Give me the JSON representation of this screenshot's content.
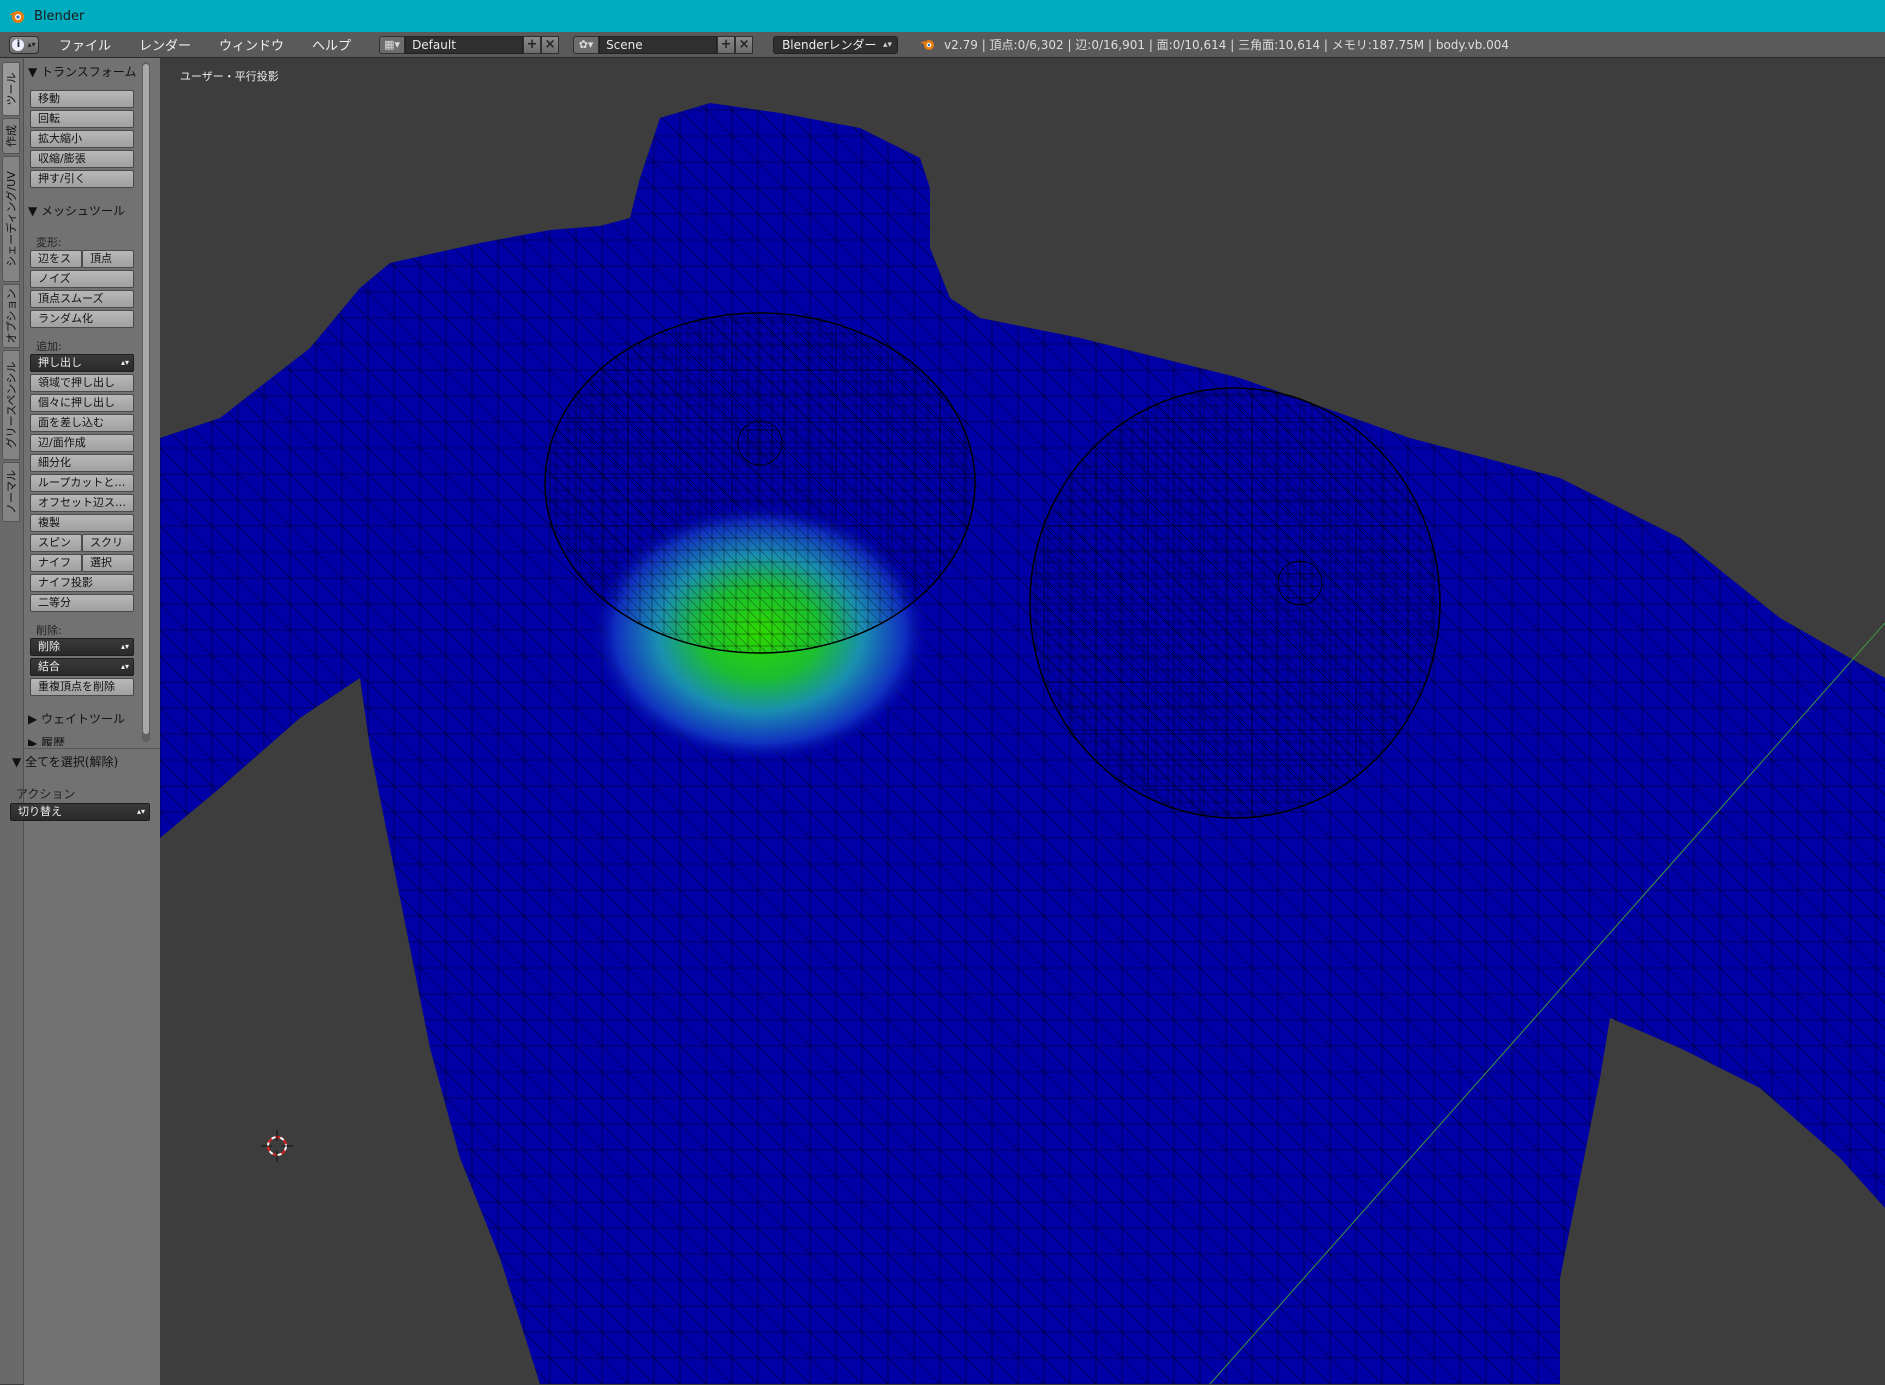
{
  "window": {
    "title": "Blender"
  },
  "menu": {
    "file": "ファイル",
    "render": "レンダー",
    "window": "ウィンドウ",
    "help": "ヘルプ"
  },
  "layout": {
    "screen": "Default",
    "scene": "Scene",
    "engine": "Blenderレンダー"
  },
  "stats": {
    "text": "v2.79 | 頂点:0/6,302 | 辺:0/16,901 | 面:0/10,614 | 三角面:10,614 | メモリ:187.75M | body.vb.004"
  },
  "vtabs": [
    "ツール",
    "作成",
    "シェーディング/UV",
    "オプション",
    "グリースペンシル",
    "ノーマル"
  ],
  "toolpanel": {
    "transform": {
      "header": "▼ トランスフォーム",
      "move": "移動",
      "rotate": "回転",
      "scale": "拡大縮小",
      "shrink": "収縮/膨張",
      "push": "押す/引く"
    },
    "mesh": {
      "header": "▼ メッシュツール",
      "deform_label": "変形:",
      "edge_slide": "辺をス",
      "vertex": "頂点",
      "noise": "ノイズ",
      "smooth": "頂点スムーズ",
      "randomize": "ランダム化",
      "add_label": "追加:",
      "extrude": "押し出し",
      "extrude_region": "領域で押し出し",
      "extrude_individual": "個々に押し出し",
      "inset": "面を差し込む",
      "edge_face": "辺/面作成",
      "subdivide": "細分化",
      "loopcut": "ループカットと…",
      "offset_edge": "オフセット辺ス…",
      "duplicate": "複製",
      "spin": "スピン",
      "screw": "スクリ",
      "knife": "ナイフ",
      "select": "選択",
      "knife_project": "ナイフ投影",
      "bisect": "二等分",
      "delete_label": "削除:",
      "delete": "削除",
      "merge": "結合",
      "remove_doubles": "重複頂点を削除"
    },
    "weight": {
      "header": "▶ ウェイトツール"
    },
    "history": {
      "header": "▶ 履歴"
    }
  },
  "redo": {
    "header": "▼ 全てを選択(解除)",
    "action_label": "アクション",
    "action_value": "切り替え"
  },
  "viewport": {
    "label": "ユーザー・平行投影"
  }
}
